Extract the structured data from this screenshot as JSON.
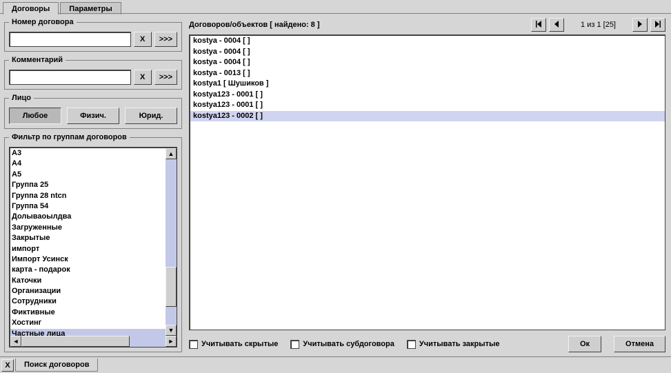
{
  "tabs": {
    "contracts": "Договоры",
    "params": "Параметры"
  },
  "contract_number": {
    "legend": "Номер договора",
    "value": "",
    "clear": "X",
    "more": ">>>"
  },
  "comment": {
    "legend": "Комментарий",
    "value": "",
    "clear": "X",
    "more": ">>>"
  },
  "person": {
    "legend": "Лицо",
    "any": "Любое",
    "phys": "Физич.",
    "jur": "Юрид."
  },
  "groups": {
    "legend": "Фильтр по группам договоров",
    "items": [
      "А3",
      "А4",
      "А5",
      "Группа 25",
      "Группа 28 ntcn",
      "Группа 54",
      "Долываоылдва",
      "Загруженные",
      "Закрытые",
      "импорт",
      "Импорт Усинск",
      "карта - подарок",
      "Каточки",
      "Организации",
      "Сотрудники",
      "Фиктивные",
      "Хостинг",
      "Частные лица"
    ],
    "selected_index": 17
  },
  "results": {
    "title": "Договоров/объектов [ найдено: 8 ]",
    "page_label": "1 из 1 [25]",
    "rows": [
      "kostya - 0004 [  ]",
      "kostya - 0004 [  ]",
      "kostya - 0004 [  ]",
      "kostya - 0013 [  ]",
      "kostya1 [ Шушиков ]",
      "kostya123 - 0001 [  ]",
      "kostya123 - 0001 [  ]",
      "kostya123 - 0002 [  ]"
    ],
    "selected_index": 7
  },
  "options": {
    "hidden": "Учитывать скрытые",
    "sub": "Учитывать субдоговора",
    "closed": "Учитывать закрытые"
  },
  "buttons": {
    "ok": "Ок",
    "cancel": "Отмена"
  },
  "bottom_tab": "Поиск договоров",
  "close_x": "X"
}
